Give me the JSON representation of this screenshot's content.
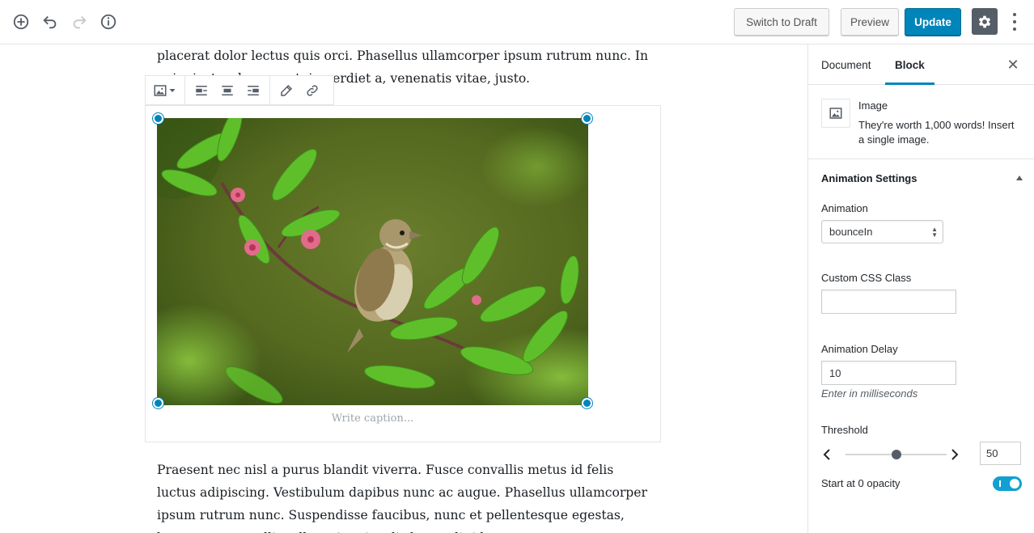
{
  "header": {
    "switch_to_draft": "Switch to Draft",
    "preview": "Preview",
    "update": "Update"
  },
  "content": {
    "para_top": "placerat dolor lectus quis orci. Phasellus ullamcorper ipsum rutrum nunc. In enim justo, rhoncus ut, imperdiet a, venenatis vitae, justo.",
    "caption_placeholder": "Write caption...",
    "para_bottom": "Praesent nec nisl a purus blandit viverra. Fusce convallis metus id felis luctus adipiscing. Vestibulum dapibus nunc ac augue. Phasellus ullamcorper ipsum rutrum nunc. Suspendisse faucibus, nunc et pellentesque egestas, lacus ante convallis tellus, vitae iaculis lacus elit id tortor."
  },
  "sidebar": {
    "tabs": [
      "Document",
      "Block"
    ],
    "active_tab": "Block",
    "block": {
      "title": "Image",
      "description": "They're worth 1,000 words! Insert a single image."
    },
    "panel": {
      "title": "Animation Settings",
      "animation_label": "Animation",
      "animation_value": "bounceIn",
      "css_class_label": "Custom CSS Class",
      "css_class_value": "",
      "delay_label": "Animation Delay",
      "delay_value": "10",
      "delay_help": "Enter in milliseconds",
      "threshold_label": "Threshold",
      "threshold_value": "50",
      "threshold_fraction": 0.5,
      "opacity_label": "Start at 0 opacity",
      "opacity_enabled": true
    }
  },
  "colors": {
    "primary": "#0085ba",
    "toggle_on": "#11a0d2",
    "settings_active": "#555d66"
  }
}
